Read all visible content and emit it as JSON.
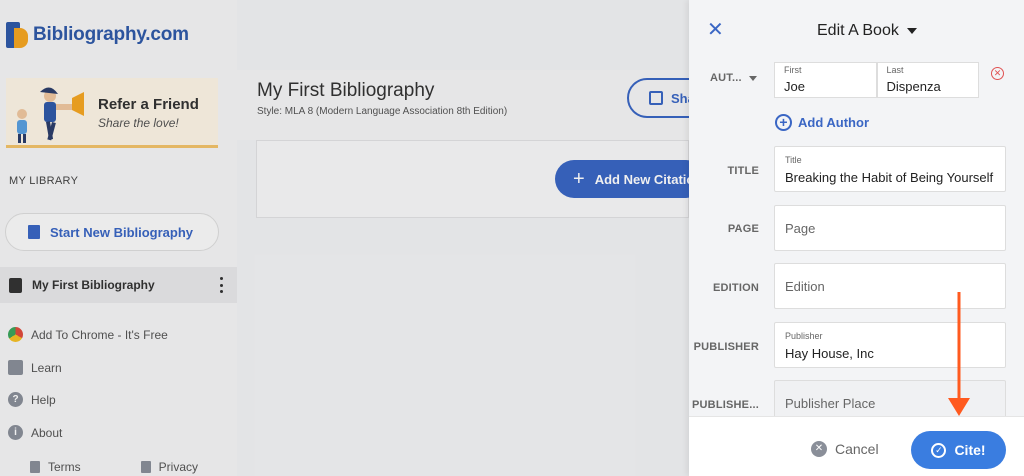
{
  "logo": {
    "text": "Bibliography.com"
  },
  "refer": {
    "title": "Refer a Friend",
    "subtitle": "Share the love!"
  },
  "sidebar": {
    "library_label": "MY LIBRARY",
    "start_button": "Start New Bibliography",
    "bibliography_item": "My First Bibliography",
    "links": [
      {
        "label": "Add To Chrome - It's Free"
      },
      {
        "label": "Learn"
      },
      {
        "label": "Help"
      },
      {
        "label": "About"
      }
    ],
    "footer": {
      "terms": "Terms",
      "privacy": "Privacy"
    }
  },
  "main": {
    "title": "My First Bibliography",
    "style": "Style: MLA 8 (Modern Language Association 8th Edition)",
    "share_label": "Sha",
    "add_citation_label": "Add New Citatio"
  },
  "panel": {
    "title": "Edit A Book",
    "author": {
      "row_label": "AUT...",
      "first_label": "First",
      "first_value": "Joe",
      "last_label": "Last",
      "last_value": "Dispenza"
    },
    "add_author": "Add Author",
    "fields": {
      "title": {
        "row_label": "TITLE",
        "label": "Title",
        "value": "Breaking the Habit of Being Yourself"
      },
      "page": {
        "row_label": "PAGE",
        "placeholder": "Page"
      },
      "edition": {
        "row_label": "EDITION",
        "placeholder": "Edition"
      },
      "publisher": {
        "row_label": "PUBLISHER",
        "label": "Publisher",
        "value": "Hay House, Inc"
      },
      "publisher_place": {
        "row_label": "PUBLISHE...",
        "placeholder": "Publisher Place"
      }
    },
    "cancel_label": "Cancel",
    "cite_label": "Cite!"
  },
  "colors": {
    "accent": "#3a66c4",
    "cite": "#3a7de0",
    "annotation_arrow": "#ff5a1f",
    "remove": "#e05252"
  }
}
